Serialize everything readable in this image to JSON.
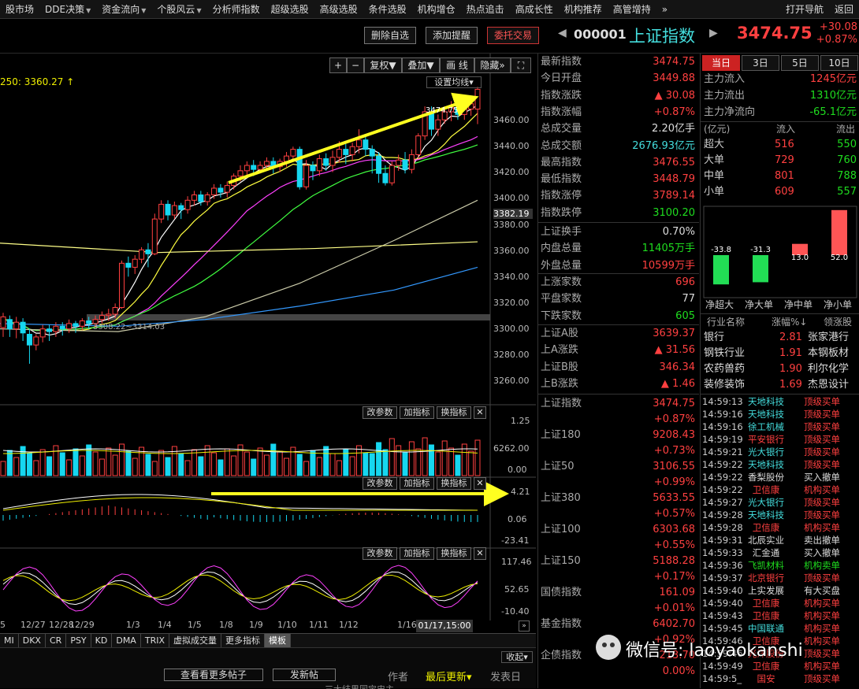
{
  "menu": {
    "items": [
      "股市场",
      "DDE决策",
      "资金流向",
      "个股风云",
      "分析师指数",
      "超级选股",
      "高级选股",
      "条件选股",
      "机构增仓",
      "热点追击",
      "高成长性",
      "机构推荐",
      "高管增持"
    ],
    "more": "»",
    "right": [
      "打开导航",
      "返回"
    ]
  },
  "titlebar": {
    "btn_del": "删除自选",
    "btn_add": "添加提醒",
    "btn_trade": "委托交易",
    "code": "000001",
    "name": "上证指数",
    "price": "3474.75",
    "chg_abs": "+30.08",
    "chg_pct": "+0.87%"
  },
  "chart": {
    "ma_label": "250: 3360.27 ↑",
    "toolbar": {
      "plus": "+",
      "minus": "−",
      "fuquan": "复权",
      "diejia": "叠加",
      "draw": "画 线",
      "hide": "隐藏",
      "expand": "⛶"
    },
    "settings": "设置均线",
    "hi_label": "3474.75",
    "lo_label": "3308.22~3314.03",
    "yticks_main": [
      "3460.00",
      "3440.00",
      "3420.00",
      "3400.00",
      "3382.19",
      "3380.00",
      "3360.00",
      "3340.00",
      "3320.00",
      "3300.00",
      "3280.00",
      "3260.00"
    ],
    "sub_buttons": {
      "gai": "改参数",
      "jia": "加指标",
      "huan": "换指标",
      "x": "✕"
    },
    "vol_ticks": [
      "1.25",
      "6262.00",
      "0.00"
    ],
    "macd_ticks": [
      "4.21",
      "0.06",
      "-23.41"
    ],
    "kdj_ticks": [
      "117.46",
      "52.65",
      "-10.40"
    ],
    "xlabels": [
      "5",
      "12/27",
      "12/28",
      "12/29",
      "1/3",
      "1/4",
      "1/5",
      "1/8",
      "1/9",
      "1/10",
      "1/11",
      "1/12",
      "1/16"
    ],
    "cursor_time": "01/17,15:00",
    "tabs": [
      "MI",
      "DKX",
      "CR",
      "PSY",
      "KD",
      "DMA",
      "TRIX",
      "虚拟成交量",
      "更多指标",
      "模板"
    ],
    "bottom": {
      "collapse": "收起",
      "more_posts": "查看看更多帖子",
      "post": "发新帖",
      "author": "作者",
      "last": "最后更新",
      "date": "发表日",
      "row": "三大结果同宝忠主"
    }
  },
  "colors": {
    "up": "#ff4040",
    "down": "#1fdd1f",
    "cyan_bar": "#16d7f0",
    "yellow": "#ffff20"
  },
  "stats1": [
    {
      "k": "最新指数",
      "v": "3474.75",
      "c": "red"
    },
    {
      "k": "今日开盘",
      "v": "3449.88",
      "c": "red"
    },
    {
      "k": "指数涨跌",
      "v": "▲ 30.08",
      "c": "red"
    },
    {
      "k": "指数涨幅",
      "v": "+0.87%",
      "c": "red"
    },
    {
      "k": "总成交量",
      "v": "2.20亿手",
      "c": "wht"
    },
    {
      "k": "总成交额",
      "v": "2676.93亿元",
      "c": "cyn"
    },
    {
      "k": "最高指数",
      "v": "3476.55",
      "c": "red"
    },
    {
      "k": "最低指数",
      "v": "3448.79",
      "c": "red"
    },
    {
      "k": "指数涨停",
      "v": "3789.14",
      "c": "red"
    },
    {
      "k": "指数跌停",
      "v": "3100.20",
      "c": "grn"
    }
  ],
  "stats2": [
    {
      "k": "上证换手",
      "v": "0.70%",
      "c": "wht"
    },
    {
      "k": "内盘总量",
      "v": "11405万手",
      "c": "grn"
    },
    {
      "k": "外盘总量",
      "v": "10599万手",
      "c": "red"
    }
  ],
  "stats3": [
    {
      "k": "上涨家数",
      "v": "696",
      "c": "red"
    },
    {
      "k": "平盘家数",
      "v": "77",
      "c": "wht"
    },
    {
      "k": "下跌家数",
      "v": "605",
      "c": "grn"
    }
  ],
  "stats4": [
    {
      "k": "上证A股",
      "v": "3639.37",
      "c": "red"
    },
    {
      "k": "上A涨跌",
      "v": "▲ 31.56",
      "c": "red"
    },
    {
      "k": "上证B股",
      "v": "346.34",
      "c": "red"
    },
    {
      "k": "上B涨跌",
      "v": "▲ 1.46",
      "c": "red"
    }
  ],
  "indices": [
    {
      "k": "上证指数",
      "v": "3474.75",
      "p": "+0.87%"
    },
    {
      "k": "上证180",
      "v": "9208.43",
      "p": "+0.73%"
    },
    {
      "k": "上证50",
      "v": "3106.55",
      "p": "+0.99%"
    },
    {
      "k": "上证380",
      "v": "5633.55",
      "p": "+0.57%"
    },
    {
      "k": "上证100",
      "v": "6303.68",
      "p": "+0.55%"
    },
    {
      "k": "上证150",
      "v": "5188.28",
      "p": "+0.17%"
    },
    {
      "k": "国债指数",
      "v": "161.09",
      "p": "+0.01%"
    },
    {
      "k": "基金指数",
      "v": "6402.70",
      "p": "+0.92%"
    },
    {
      "k": "企债指数",
      "v": "213.70",
      "p": "0.00%"
    }
  ],
  "flow": {
    "tabs": [
      "当日",
      "3日",
      "5日",
      "10日"
    ],
    "rows": [
      {
        "k": "主力流入",
        "v": "1245亿元",
        "c": "red"
      },
      {
        "k": "主力流出",
        "v": "1310亿元",
        "c": "grn"
      },
      {
        "k": "主力净流向",
        "v": "-65.1亿元",
        "c": "grn"
      }
    ],
    "head": {
      "unit": "(亿元)",
      "in": "流入",
      "out": "流出"
    },
    "detail": [
      {
        "k": "超大",
        "i": "516",
        "o": "550"
      },
      {
        "k": "大单",
        "i": "729",
        "o": "760"
      },
      {
        "k": "中单",
        "i": "801",
        "o": "788"
      },
      {
        "k": "小单",
        "i": "609",
        "o": "557"
      }
    ],
    "bars": [
      {
        "label": "净超大",
        "value": -33.8,
        "text": "-33.8"
      },
      {
        "label": "净大单",
        "value": -31.3,
        "text": "-31.3"
      },
      {
        "label": "净中单",
        "value": 13.0,
        "text": "13.0"
      },
      {
        "label": "净小单",
        "value": 52.0,
        "text": "52.0"
      }
    ]
  },
  "industry": {
    "head": [
      "行业名称",
      "涨幅%↓",
      "领涨股"
    ],
    "rows": [
      [
        "银行",
        "2.81",
        "张家港行"
      ],
      [
        "钢铁行业",
        "1.91",
        "本钢板材"
      ],
      [
        "农药兽药",
        "1.90",
        "利尔化学"
      ],
      [
        "装修装饰",
        "1.69",
        "杰恩设计"
      ]
    ]
  },
  "trades": [
    {
      "t": "14:59:13",
      "n": "天地科技",
      "a": "顶级买单",
      "nc": "cyn",
      "ac": "red"
    },
    {
      "t": "14:59:16",
      "n": "天地科技",
      "a": "顶级买单",
      "nc": "cyn",
      "ac": "red"
    },
    {
      "t": "14:59:16",
      "n": "徐工机械",
      "a": "顶级买单",
      "nc": "cyn",
      "ac": "red"
    },
    {
      "t": "14:59:19",
      "n": "平安银行",
      "a": "顶级买单",
      "nc": "red",
      "ac": "red"
    },
    {
      "t": "14:59:21",
      "n": "光大银行",
      "a": "顶级买单",
      "nc": "cyn",
      "ac": "red"
    },
    {
      "t": "14:59:22",
      "n": "天地科技",
      "a": "顶级买单",
      "nc": "cyn",
      "ac": "red"
    },
    {
      "t": "14:59:22",
      "n": "香梨股份",
      "a": "买入撤单",
      "nc": "wht",
      "ac": "wht"
    },
    {
      "t": "14:59:22",
      "n": "卫信康",
      "a": "机构买单",
      "nc": "red",
      "ac": "red"
    },
    {
      "t": "14:59:27",
      "n": "光大银行",
      "a": "顶级买单",
      "nc": "cyn",
      "ac": "red"
    },
    {
      "t": "14:59:28",
      "n": "天地科技",
      "a": "顶级买单",
      "nc": "cyn",
      "ac": "red"
    },
    {
      "t": "14:59:28",
      "n": "卫信康",
      "a": "机构买单",
      "nc": "red",
      "ac": "red"
    },
    {
      "t": "14:59:31",
      "n": "北辰实业",
      "a": "卖出撤单",
      "nc": "wht",
      "ac": "wht"
    },
    {
      "t": "14:59:33",
      "n": "汇金通",
      "a": "买入撤单",
      "nc": "wht",
      "ac": "wht"
    },
    {
      "t": "14:59:36",
      "n": "飞凯材料",
      "a": "机构卖单",
      "nc": "grn",
      "ac": "grn"
    },
    {
      "t": "14:59:37",
      "n": "北京银行",
      "a": "顶级买单",
      "nc": "red",
      "ac": "red"
    },
    {
      "t": "14:59:40",
      "n": "上实发展",
      "a": "有大买盘",
      "nc": "wht",
      "ac": "wht"
    },
    {
      "t": "14:59:40",
      "n": "卫信康",
      "a": "机构买单",
      "nc": "red",
      "ac": "red"
    },
    {
      "t": "14:59:43",
      "n": "卫信康",
      "a": "机构买单",
      "nc": "red",
      "ac": "red"
    },
    {
      "t": "14:59:45",
      "n": "中国联通",
      "a": "机构买单",
      "nc": "cyn",
      "ac": "red"
    },
    {
      "t": "14:59:46",
      "n": "卫信康",
      "a": "机构买单",
      "nc": "red",
      "ac": "red"
    },
    {
      "t": "14:59:46",
      "n": "光洋股份",
      "a": "顶级买单",
      "nc": "red",
      "ac": "red"
    },
    {
      "t": "14:59:49",
      "n": "卫信康",
      "a": "机构买单",
      "nc": "red",
      "ac": "red"
    },
    {
      "t": "14:59:5_",
      "n": "国安",
      "a": "顶级买单",
      "nc": "red",
      "ac": "red"
    }
  ],
  "watermark": "微信号: laoyaokanshi",
  "chart_data": {
    "type": "candlestick",
    "ylim": [
      3250,
      3485
    ],
    "yticks": [
      3260,
      3280,
      3300,
      3320,
      3340,
      3360,
      3380,
      3400,
      3420,
      3440,
      3460
    ],
    "candles": [
      [
        3297,
        3305,
        3290,
        3308
      ],
      [
        3303,
        3296,
        3290,
        3306
      ],
      [
        3296,
        3301,
        3289,
        3305
      ],
      [
        3301,
        3293,
        3287,
        3304
      ],
      [
        3292,
        3284,
        3270,
        3296
      ],
      [
        3284,
        3290,
        3280,
        3292
      ],
      [
        3290,
        3296,
        3286,
        3299
      ],
      [
        3296,
        3294,
        3287,
        3299
      ],
      [
        3294,
        3298,
        3290,
        3301
      ],
      [
        3298,
        3296,
        3291,
        3301
      ],
      [
        3296,
        3300,
        3293,
        3303
      ],
      [
        3300,
        3298,
        3293,
        3302
      ],
      [
        3298,
        3302,
        3295,
        3304
      ],
      [
        3302,
        3300,
        3296,
        3305
      ],
      [
        3300,
        3303,
        3297,
        3306
      ],
      [
        3303,
        3306,
        3300,
        3309
      ],
      [
        3306,
        3307,
        3302,
        3311
      ],
      [
        3307,
        3312,
        3304,
        3315
      ],
      [
        3312,
        3345,
        3311,
        3347
      ],
      [
        3345,
        3342,
        3335,
        3350
      ],
      [
        3342,
        3348,
        3337,
        3351
      ],
      [
        3348,
        3355,
        3345,
        3357
      ],
      [
        3355,
        3352,
        3342,
        3360
      ],
      [
        3352,
        3378,
        3351,
        3382
      ],
      [
        3378,
        3389,
        3375,
        3392
      ],
      [
        3389,
        3381,
        3377,
        3392
      ],
      [
        3381,
        3388,
        3378,
        3391
      ],
      [
        3388,
        3385,
        3378,
        3390
      ],
      [
        3385,
        3392,
        3382,
        3395
      ],
      [
        3392,
        3396,
        3388,
        3399
      ],
      [
        3396,
        3391,
        3388,
        3399
      ],
      [
        3391,
        3396,
        3388,
        3398
      ],
      [
        3396,
        3401,
        3393,
        3404
      ],
      [
        3401,
        3398,
        3394,
        3404
      ],
      [
        3398,
        3403,
        3394,
        3406
      ],
      [
        3403,
        3410,
        3400,
        3412
      ],
      [
        3410,
        3414,
        3406,
        3418
      ],
      [
        3414,
        3418,
        3410,
        3421
      ],
      [
        3418,
        3415,
        3410,
        3422
      ],
      [
        3415,
        3418,
        3412,
        3421
      ],
      [
        3418,
        3421,
        3414,
        3424
      ],
      [
        3421,
        3417,
        3412,
        3424
      ],
      [
        3417,
        3421,
        3413,
        3423
      ],
      [
        3421,
        3425,
        3417,
        3428
      ],
      [
        3425,
        3430,
        3421,
        3432
      ],
      [
        3430,
        3402,
        3400,
        3432
      ],
      [
        3402,
        3418,
        3400,
        3422
      ],
      [
        3418,
        3414,
        3407,
        3421
      ],
      [
        3414,
        3423,
        3410,
        3426
      ],
      [
        3423,
        3418,
        3414,
        3427
      ],
      [
        3418,
        3424,
        3413,
        3429
      ],
      [
        3424,
        3430,
        3420,
        3436
      ],
      [
        3430,
        3426,
        3419,
        3434
      ],
      [
        3426,
        3432,
        3421,
        3435
      ],
      [
        3432,
        3437,
        3427,
        3445
      ],
      [
        3437,
        3430,
        3425,
        3440
      ],
      [
        3430,
        3425,
        3412,
        3433
      ],
      [
        3425,
        3412,
        3405,
        3428
      ],
      [
        3412,
        3405,
        3403,
        3418
      ],
      [
        3405,
        3418,
        3403,
        3421
      ],
      [
        3418,
        3422,
        3414,
        3426
      ],
      [
        3422,
        3415,
        3412,
        3428
      ],
      [
        3415,
        3426,
        3412,
        3430
      ],
      [
        3426,
        3440,
        3423,
        3442
      ],
      [
        3440,
        3458,
        3437,
        3462
      ],
      [
        3458,
        3445,
        3440,
        3462
      ],
      [
        3445,
        3452,
        3440,
        3456
      ],
      [
        3452,
        3458,
        3449,
        3462
      ],
      [
        3458,
        3461,
        3451,
        3466
      ],
      [
        3461,
        3456,
        3452,
        3464
      ],
      [
        3456,
        3460,
        3452,
        3465
      ],
      [
        3460,
        3464,
        3455,
        3470
      ],
      [
        3460,
        3474.75,
        3448.79,
        3476.55
      ]
    ]
  }
}
